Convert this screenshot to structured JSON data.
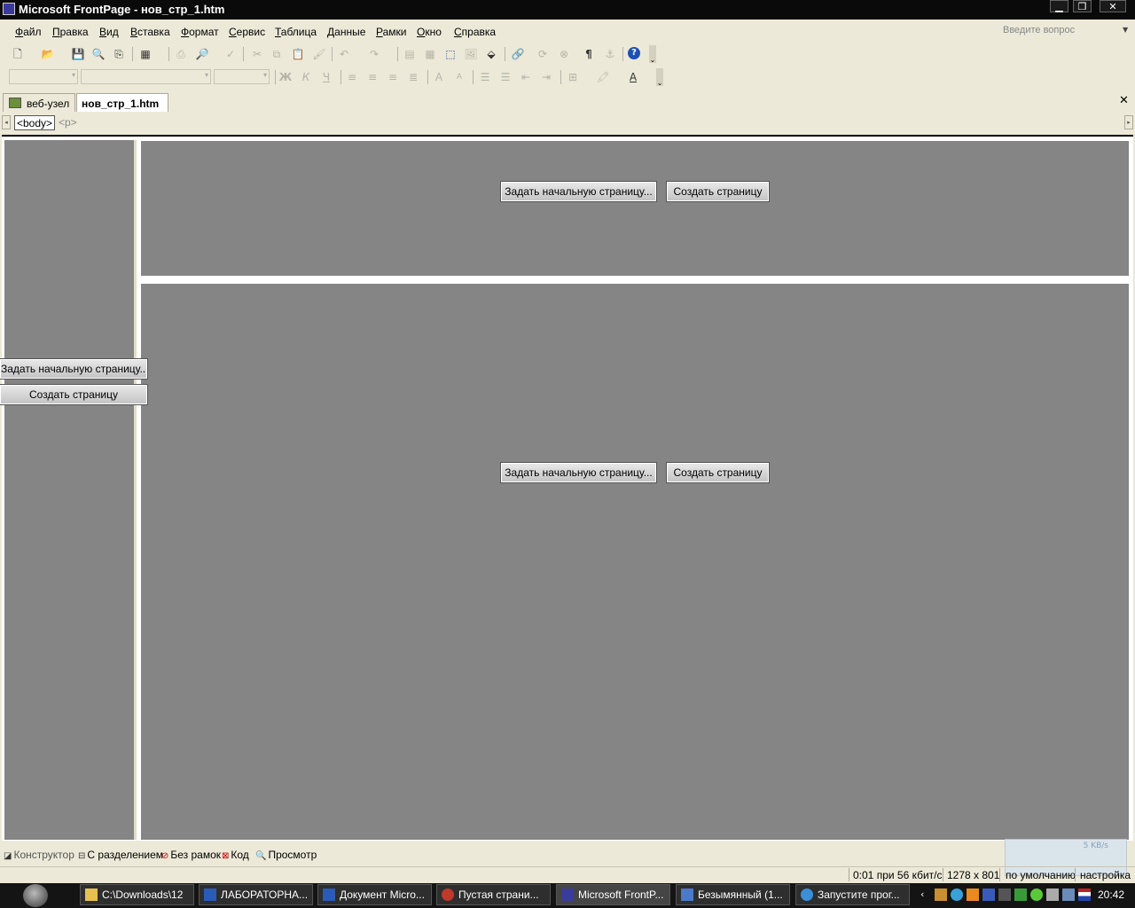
{
  "window": {
    "title": "Microsoft FrontPage - нов_стр_1.htm",
    "minimize_glyph": "▁",
    "restore_glyph": "❐",
    "close_glyph": "✕"
  },
  "menu": {
    "items": [
      "Файл",
      "Правка",
      "Вид",
      "Вставка",
      "Формат",
      "Сервис",
      "Таблица",
      "Данные",
      "Рамки",
      "Окно",
      "Справка"
    ],
    "help_placeholder": "Введите вопрос"
  },
  "tabs": {
    "site": "веб-узел",
    "document": "нов_стр_1.htm",
    "close_glyph": "✕"
  },
  "tagbar": {
    "tags": [
      "<body>",
      "<p>"
    ]
  },
  "frames": {
    "set_start_label": "Задать начальную страницу...",
    "create_label": "Создать страницу"
  },
  "views": [
    "Конструктор",
    "С разделением",
    "Без рамок",
    "Код",
    "Просмотр"
  ],
  "status": {
    "speed": "0:01 при 56 кбит/с",
    "size": "1278 x 801",
    "default": "по умолчанию",
    "custom": "настройка",
    "network": "5 KB/s"
  },
  "taskbar": {
    "tasks": [
      "C:\\Downloads\\12",
      "ЛАБОРАТОРНА...",
      "Документ Micro...",
      "Пустая страни...",
      "Microsoft FrontP...",
      "Безымянный (1...",
      "Запустите прог..."
    ],
    "clock": "20:42"
  },
  "colors": {
    "frame_bg": "#858585",
    "titlebar_bg": "#0a0a0a",
    "taskbar_bg": "#141414",
    "chrome_bg": "#ece9d8"
  }
}
